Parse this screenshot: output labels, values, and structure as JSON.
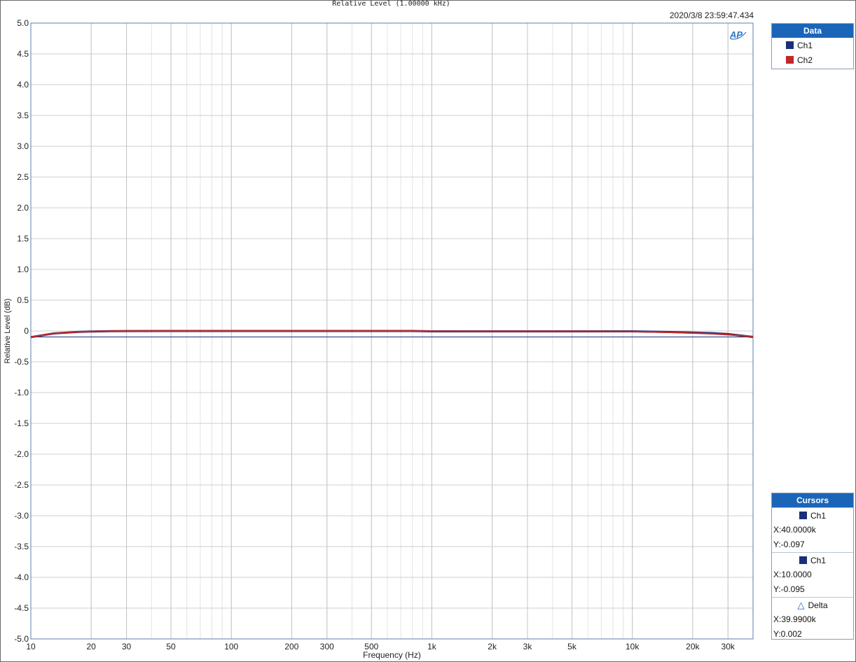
{
  "title": "Relative Level (1.00000 kHz)",
  "timestamp": "2020/3/8 23:59:47.434",
  "logo_text": "AP",
  "chart_data": {
    "type": "line",
    "xlabel": "Frequency (Hz)",
    "ylabel": "Relative Level (dB)",
    "x_scale": "log",
    "xlim": [
      10,
      40000
    ],
    "ylim": [
      -5.0,
      5.0
    ],
    "grid": true,
    "legend_placement": "right",
    "x_ticks": [
      {
        "value": 10,
        "label": "10"
      },
      {
        "value": 20,
        "label": "20"
      },
      {
        "value": 30,
        "label": "30"
      },
      {
        "value": 50,
        "label": "50"
      },
      {
        "value": 100,
        "label": "100"
      },
      {
        "value": 200,
        "label": "200"
      },
      {
        "value": 300,
        "label": "300"
      },
      {
        "value": 500,
        "label": "500"
      },
      {
        "value": 1000,
        "label": "1k"
      },
      {
        "value": 2000,
        "label": "2k"
      },
      {
        "value": 3000,
        "label": "3k"
      },
      {
        "value": 5000,
        "label": "5k"
      },
      {
        "value": 10000,
        "label": "10k"
      },
      {
        "value": 20000,
        "label": "20k"
      },
      {
        "value": 30000,
        "label": "30k"
      }
    ],
    "y_ticks": [
      {
        "value": 5.0,
        "label": "5.0"
      },
      {
        "value": 4.5,
        "label": "4.5"
      },
      {
        "value": 4.0,
        "label": "4.0"
      },
      {
        "value": 3.5,
        "label": "3.5"
      },
      {
        "value": 3.0,
        "label": "3.0"
      },
      {
        "value": 2.5,
        "label": "2.5"
      },
      {
        "value": 2.0,
        "label": "2.0"
      },
      {
        "value": 1.5,
        "label": "1.5"
      },
      {
        "value": 1.0,
        "label": "1.0"
      },
      {
        "value": 0.5,
        "label": "0.5"
      },
      {
        "value": 0,
        "label": "0"
      },
      {
        "value": -0.5,
        "label": "-0.5"
      },
      {
        "value": -1.0,
        "label": "-1.0"
      },
      {
        "value": -1.5,
        "label": "-1.5"
      },
      {
        "value": -2.0,
        "label": "-2.0"
      },
      {
        "value": -2.5,
        "label": "-2.5"
      },
      {
        "value": -3.0,
        "label": "-3.0"
      },
      {
        "value": -3.5,
        "label": "-3.5"
      },
      {
        "value": -4.0,
        "label": "-4.0"
      },
      {
        "value": -4.5,
        "label": "-4.5"
      },
      {
        "value": -5.0,
        "label": "-5.0"
      }
    ],
    "series": [
      {
        "name": "Ch1",
        "color": "#1a2f7a",
        "points": [
          [
            10,
            -0.1
          ],
          [
            13,
            -0.04
          ],
          [
            17,
            -0.015
          ],
          [
            20,
            -0.008
          ],
          [
            25,
            -0.003
          ],
          [
            30,
            -0.001
          ],
          [
            50,
            0.0
          ],
          [
            100,
            0.0
          ],
          [
            200,
            0.0
          ],
          [
            500,
            0.0
          ],
          [
            800,
            0.0
          ],
          [
            1000,
            -0.005
          ],
          [
            2000,
            -0.006
          ],
          [
            5000,
            -0.006
          ],
          [
            10000,
            -0.006
          ],
          [
            15000,
            -0.015
          ],
          [
            20000,
            -0.025
          ],
          [
            25000,
            -0.035
          ],
          [
            30000,
            -0.05
          ],
          [
            40000,
            -0.097
          ]
        ]
      },
      {
        "name": "Ch2",
        "color": "#c0282a",
        "points": [
          [
            10,
            -0.1
          ],
          [
            13,
            -0.04
          ],
          [
            17,
            -0.015
          ],
          [
            20,
            -0.008
          ],
          [
            25,
            -0.003
          ],
          [
            30,
            -0.001
          ],
          [
            50,
            0.0
          ],
          [
            100,
            0.0
          ],
          [
            200,
            0.0
          ],
          [
            500,
            0.0
          ],
          [
            800,
            0.0
          ],
          [
            1000,
            -0.005
          ],
          [
            2000,
            -0.006
          ],
          [
            5000,
            -0.006
          ],
          [
            10000,
            -0.008
          ],
          [
            15000,
            -0.02
          ],
          [
            20000,
            -0.033
          ],
          [
            25000,
            -0.045
          ],
          [
            30000,
            -0.06
          ],
          [
            40000,
            -0.09
          ]
        ]
      }
    ],
    "cursor_line": {
      "y": -0.097,
      "color": "#1a2f7a"
    }
  },
  "legend": {
    "header": "Data",
    "items": [
      {
        "label": "Ch1",
        "color": "#1a2f7a"
      },
      {
        "label": "Ch2",
        "color": "#c0282a"
      }
    ]
  },
  "cursors": {
    "header": "Cursors",
    "cursor1": {
      "channel": "Ch1",
      "color": "#1a2f7a",
      "x": "X:40.0000k",
      "y": "Y:-0.097"
    },
    "cursor2": {
      "channel": "Ch1",
      "color": "#1a2f7a",
      "x": "X:10.0000",
      "y": "Y:-0.095"
    },
    "delta": {
      "label": "Delta",
      "x": "X:39.9900k",
      "y": "Y:0.002"
    }
  }
}
